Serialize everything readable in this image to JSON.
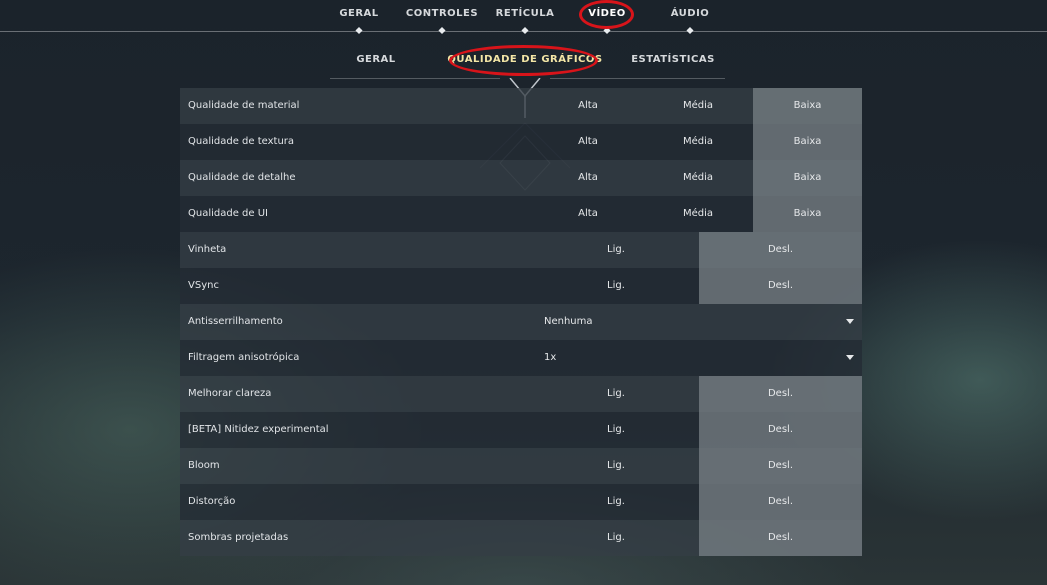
{
  "top_tabs": [
    {
      "label": "GERAL"
    },
    {
      "label": "CONTROLES"
    },
    {
      "label": "RETÍCULA"
    },
    {
      "label": "VÍDEO"
    },
    {
      "label": "ÁUDIO"
    }
  ],
  "active_top_tab": "VÍDEO",
  "sub_tabs": [
    {
      "label": "GERAL"
    },
    {
      "label": "QUALIDADE DE GRÁFICOS"
    },
    {
      "label": "ESTATÍSTICAS"
    }
  ],
  "active_sub_tab": "QUALIDADE DE GRÁFICOS",
  "settings": [
    {
      "label": "Qualidade de material",
      "options": [
        "Alta",
        "Média",
        "Baixa"
      ],
      "selected": "Baixa"
    },
    {
      "label": "Qualidade de textura",
      "options": [
        "Alta",
        "Média",
        "Baixa"
      ],
      "selected": "Baixa"
    },
    {
      "label": "Qualidade de detalhe",
      "options": [
        "Alta",
        "Média",
        "Baixa"
      ],
      "selected": "Baixa"
    },
    {
      "label": "Qualidade de UI",
      "options": [
        "Alta",
        "Média",
        "Baixa"
      ],
      "selected": "Baixa"
    },
    {
      "label": "Vinheta",
      "options": [
        "Lig.",
        "Desl."
      ],
      "selected": "Desl."
    },
    {
      "label": "VSync",
      "options": [
        "Lig.",
        "Desl."
      ],
      "selected": "Desl."
    },
    {
      "label": "Antisserrilhamento",
      "dropdown_value": "Nenhuma"
    },
    {
      "label": "Filtragem anisotrópica",
      "dropdown_value": "1x"
    },
    {
      "label": "Melhorar clareza",
      "options": [
        "Lig.",
        "Desl."
      ],
      "selected": "Desl."
    },
    {
      "label": "[BETA] Nitidez experimental",
      "options": [
        "Lig.",
        "Desl."
      ],
      "selected": "Desl."
    },
    {
      "label": "Bloom",
      "options": [
        "Lig.",
        "Desl."
      ],
      "selected": "Desl."
    },
    {
      "label": "Distorção",
      "options": [
        "Lig.",
        "Desl."
      ],
      "selected": "Desl."
    },
    {
      "label": "Sombras projetadas",
      "options": [
        "Lig.",
        "Desl."
      ],
      "selected": "Desl."
    }
  ],
  "annotation_color": "#d8141a",
  "accent_color": "#f3e6a6"
}
